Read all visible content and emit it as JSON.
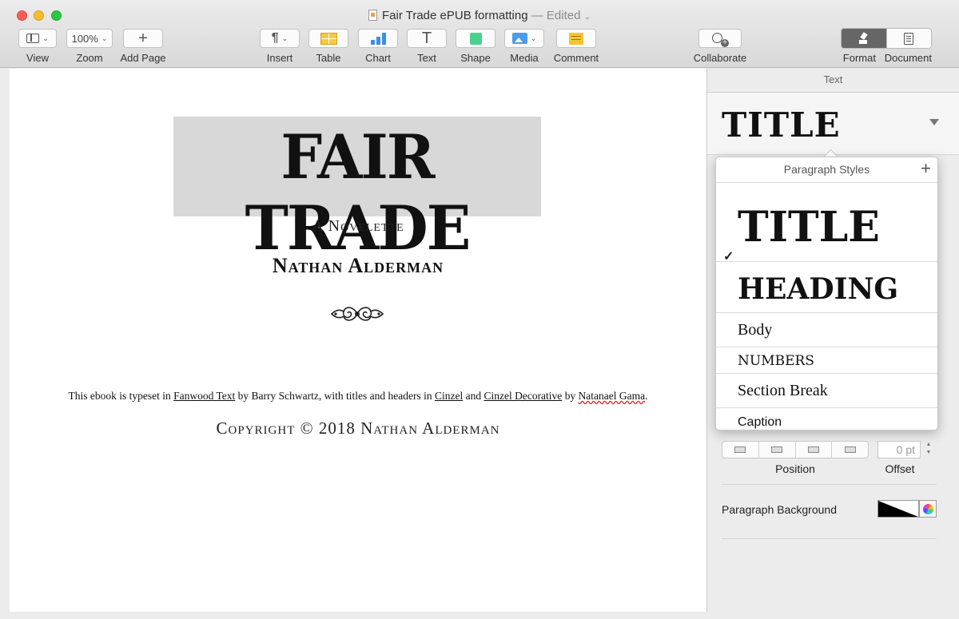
{
  "window": {
    "title": "Fair Trade ePUB formatting",
    "status": "— Edited",
    "status_chevron": "⌄"
  },
  "toolbar": {
    "view_label": "View",
    "zoom_value": "100%",
    "zoom_label": "Zoom",
    "add_page_label": "Add Page",
    "insert_label": "Insert",
    "table_label": "Table",
    "chart_label": "Chart",
    "text_label": "Text",
    "shape_label": "Shape",
    "media_label": "Media",
    "comment_label": "Comment",
    "collaborate_label": "Collaborate",
    "format_label": "Format",
    "document_label": "Document"
  },
  "document": {
    "title": "FAIR TRADE",
    "subtitle": "A Novelette",
    "author": "Nathan Alderman",
    "note": {
      "p1": "This ebook is typeset in ",
      "font1": "Fanwood Text",
      "p2": " by Barry Schwartz, with titles and headers in ",
      "font2": "Cinzel",
      "p3": " and ",
      "font3": "Cinzel Decorative",
      "p4": " by ",
      "designer": "Natanael Gama",
      "p5": "."
    },
    "copyright": "Copyright © 2018 Nathan Alderman"
  },
  "sidebar": {
    "tab": "Text",
    "current_style": "TITLE",
    "popover": {
      "header": "Paragraph Styles",
      "add": "+",
      "check": "✓",
      "styles": [
        "TITLE",
        "HEADING",
        "Body",
        "NUMBERS",
        "Section Break",
        "Caption"
      ]
    },
    "position_label": "Position",
    "offset_label": "Offset",
    "offset_value": "0 pt",
    "paragraph_background_label": "Paragraph Background"
  }
}
